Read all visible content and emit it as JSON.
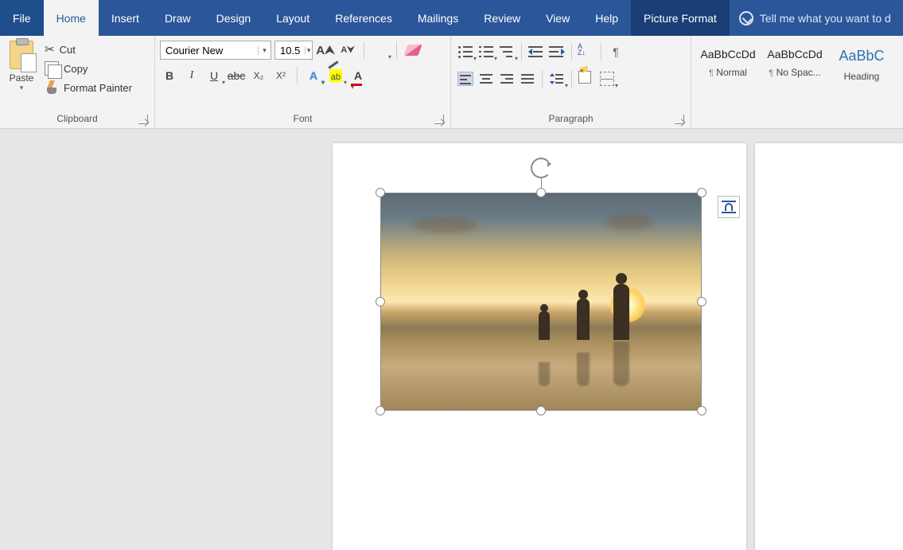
{
  "tabs": {
    "file": "File",
    "home": "Home",
    "insert": "Insert",
    "draw": "Draw",
    "design": "Design",
    "layout": "Layout",
    "references": "References",
    "mailings": "Mailings",
    "review": "Review",
    "view": "View",
    "help": "Help",
    "picture_format": "Picture Format",
    "tell_me": "Tell me what you want to d"
  },
  "clipboard": {
    "paste": "Paste",
    "cut": "Cut",
    "copy": "Copy",
    "format_painter": "Format Painter",
    "group_label": "Clipboard"
  },
  "font": {
    "name": "Courier New",
    "size": "10.5",
    "group_label": "Font"
  },
  "paragraph": {
    "group_label": "Paragraph"
  },
  "styles": {
    "sample": "AaBbCcDd",
    "sample_heading": "AaBbC",
    "normal": "Normal",
    "no_spacing": "No Spac...",
    "heading1": "Heading"
  },
  "picture": {
    "description": "Sunset beach photo with silhouettes of three people"
  }
}
